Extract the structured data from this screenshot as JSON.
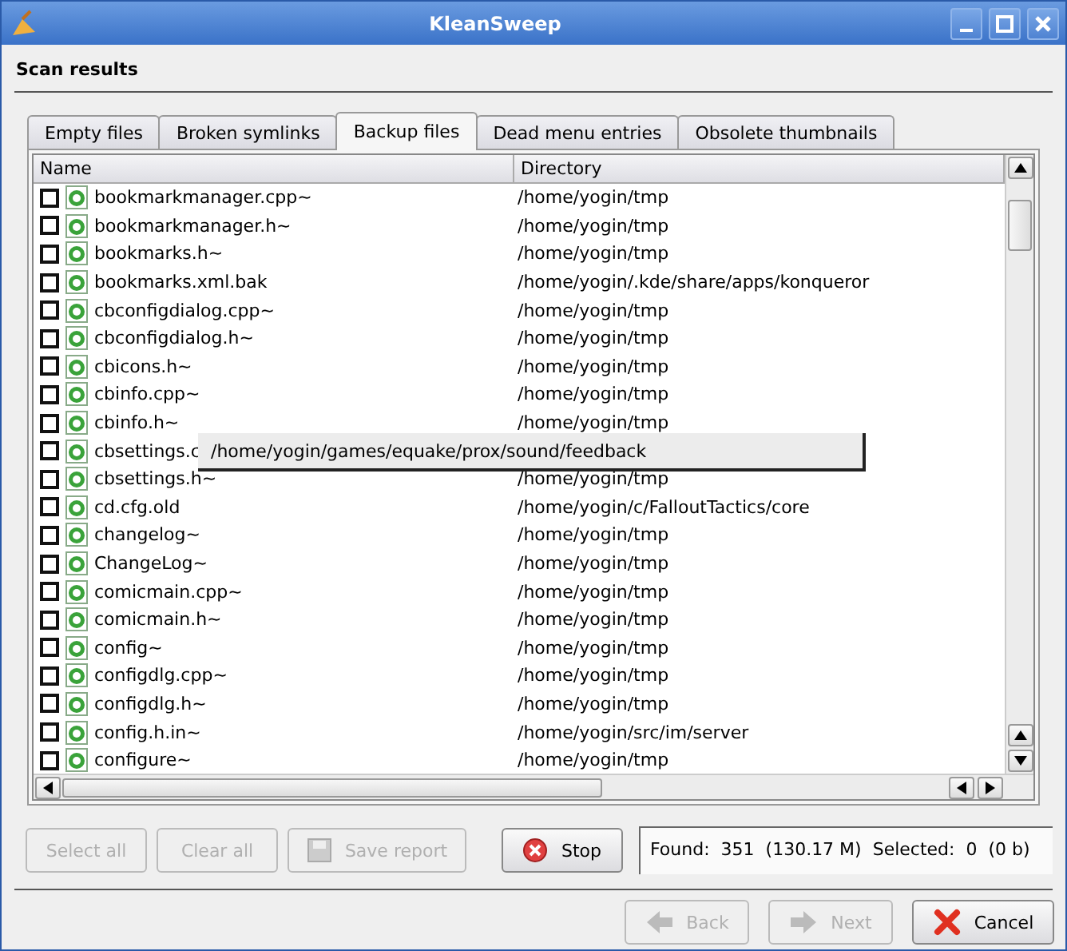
{
  "window": {
    "title": "KleanSweep"
  },
  "heading": "Scan results",
  "tabs": [
    {
      "label": "Empty files",
      "selected": false
    },
    {
      "label": "Broken symlinks",
      "selected": false
    },
    {
      "label": "Backup files",
      "selected": true
    },
    {
      "label": "Dead menu entries",
      "selected": false
    },
    {
      "label": "Obsolete thumbnails",
      "selected": false
    }
  ],
  "table": {
    "columns": [
      "Name",
      "Directory"
    ],
    "rows": [
      {
        "name": "bookmarkmanager.cpp~",
        "directory": "/home/yogin/tmp",
        "checked": false
      },
      {
        "name": "bookmarkmanager.h~",
        "directory": "/home/yogin/tmp",
        "checked": false
      },
      {
        "name": "bookmarks.h~",
        "directory": "/home/yogin/tmp",
        "checked": false
      },
      {
        "name": "bookmarks.xml.bak",
        "directory": "/home/yogin/.kde/share/apps/konqueror",
        "checked": false
      },
      {
        "name": "cbconfigdialog.cpp~",
        "directory": "/home/yogin/tmp",
        "checked": false
      },
      {
        "name": "cbconfigdialog.h~",
        "directory": "/home/yogin/tmp",
        "checked": false
      },
      {
        "name": "cbicons.h~",
        "directory": "/home/yogin/tmp",
        "checked": false
      },
      {
        "name": "cbinfo.cpp~",
        "directory": "/home/yogin/tmp",
        "checked": false
      },
      {
        "name": "cbinfo.h~",
        "directory": "/home/yogin/tmp",
        "checked": false
      },
      {
        "name": "cbsettings.c",
        "checked": false
      },
      {
        "name": "cbsettings.h~",
        "directory": "/home/yogin/tmp",
        "checked": false
      },
      {
        "name": "cd.cfg.old",
        "directory": "/home/yogin/c/FalloutTactics/core",
        "checked": false
      },
      {
        "name": "changelog~",
        "directory": "/home/yogin/tmp",
        "checked": false
      },
      {
        "name": "ChangeLog~",
        "directory": "/home/yogin/tmp",
        "checked": false
      },
      {
        "name": "comicmain.cpp~",
        "directory": "/home/yogin/tmp",
        "checked": false
      },
      {
        "name": "comicmain.h~",
        "directory": "/home/yogin/tmp",
        "checked": false
      },
      {
        "name": "config~",
        "directory": "/home/yogin/tmp",
        "checked": false
      },
      {
        "name": "configdlg.cpp~",
        "directory": "/home/yogin/tmp",
        "checked": false
      },
      {
        "name": "configdlg.h~",
        "directory": "/home/yogin/tmp",
        "checked": false
      },
      {
        "name": "config.h.in~",
        "directory": "/home/yogin/src/im/server",
        "checked": false
      },
      {
        "name": "configure~",
        "directory": "/home/yogin/tmp",
        "checked": false
      }
    ]
  },
  "tooltip": "/home/yogin/games/equake/prox/sound/feedback",
  "actions": [
    {
      "label": "Select all",
      "disabled": true
    },
    {
      "label": "Clear all",
      "disabled": true
    },
    {
      "label": "Save report",
      "disabled": true
    }
  ],
  "stop_button": "Stop",
  "status": "Found:  351  (130.17 M)  Selected:  0  (0 b)",
  "nav_buttons": [
    {
      "label": "Back",
      "disabled": true
    },
    {
      "label": "Next",
      "disabled": true
    },
    {
      "label": "Cancel",
      "disabled": false
    }
  ]
}
